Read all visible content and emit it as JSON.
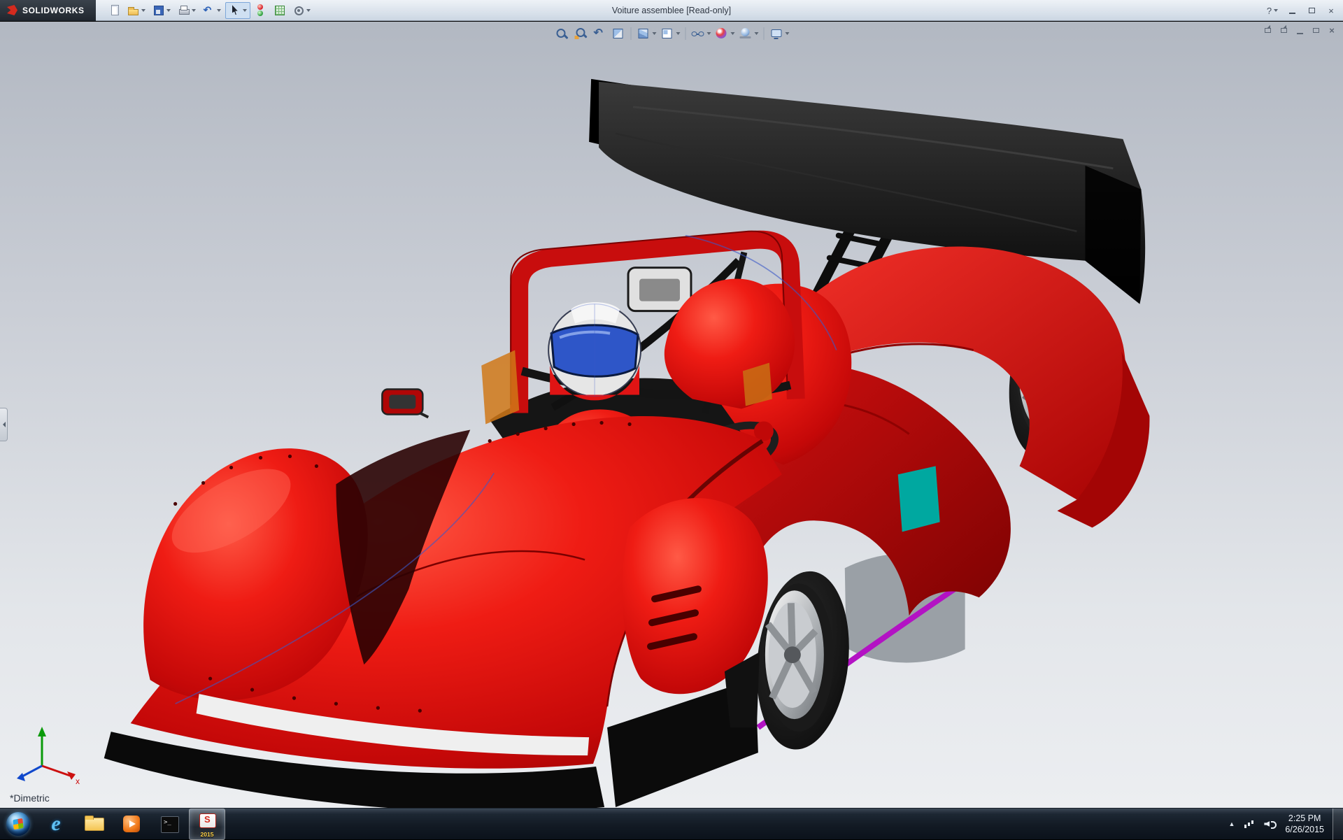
{
  "window": {
    "brand": "SOLIDWORKS",
    "title": "Voiture assemblee [Read-only]",
    "help_label": "?"
  },
  "main_toolbar": {
    "items": [
      {
        "name": "new-document"
      },
      {
        "name": "open",
        "dropdown": true
      },
      {
        "name": "save",
        "dropdown": true
      },
      {
        "name": "print",
        "dropdown": true
      },
      {
        "name": "undo",
        "dropdown": true
      },
      {
        "name": "select",
        "dropdown": true,
        "active": true
      },
      {
        "name": "rebuild"
      },
      {
        "name": "file-properties"
      },
      {
        "name": "options",
        "dropdown": true
      }
    ]
  },
  "headsup_toolbar": {
    "items": [
      {
        "name": "zoom-to-fit"
      },
      {
        "name": "zoom-to-area"
      },
      {
        "name": "previous-view"
      },
      {
        "name": "section-view"
      },
      {
        "name": "separator"
      },
      {
        "name": "view-orientation",
        "dropdown": true
      },
      {
        "name": "display-style",
        "dropdown": true
      },
      {
        "name": "separator"
      },
      {
        "name": "hide-show-items",
        "dropdown": true
      },
      {
        "name": "edit-appearance",
        "dropdown": true
      },
      {
        "name": "apply-scene",
        "dropdown": true
      },
      {
        "name": "separator"
      },
      {
        "name": "view-settings",
        "dropdown": true
      }
    ]
  },
  "document_controls": {
    "items": [
      "new-window",
      "cascade",
      "minimize-document",
      "restore-document",
      "close-document"
    ]
  },
  "viewport": {
    "view_label": "*Dimetric",
    "triad_x_label": "x",
    "background_top": "#b2b8c2",
    "background_bottom": "#eceef1"
  },
  "model": {
    "name": "red prototype race car assembly with driver",
    "colors": {
      "body-red": "#e01414",
      "body-red-dark": "#a80808",
      "wing-black": "#0d0d0d",
      "rim-silver": "#c8cacc",
      "harness-yellow": "#e8cc14",
      "visor-blue": "#2e56c8",
      "accent-teal": "#00a8a0",
      "accent-purple": "#b312c4"
    }
  },
  "taskbar": {
    "time": "2:25 PM",
    "date": "6/26/2015",
    "items": [
      {
        "name": "start"
      },
      {
        "name": "internet-explorer"
      },
      {
        "name": "windows-explorer"
      },
      {
        "name": "media-player"
      },
      {
        "name": "command-prompt"
      },
      {
        "name": "solidworks-2015",
        "badge": "2015",
        "active": true
      }
    ],
    "tray": [
      {
        "name": "show-hidden-icons"
      },
      {
        "name": "network"
      },
      {
        "name": "volume"
      }
    ]
  }
}
